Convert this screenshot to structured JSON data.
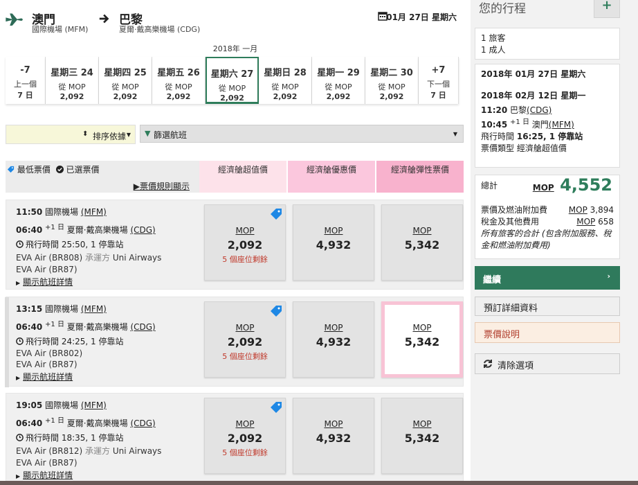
{
  "header": {
    "origin_city": "澳門",
    "origin_airport": "國際機場 (MFM)",
    "dest_city": "巴黎",
    "dest_airport": "夏爾·戴高樂機場 (CDG)",
    "date": "01月 27日 星期六"
  },
  "month_label": "2018年 一月",
  "dates": [
    {
      "name": "-7",
      "from": "上一個",
      "price": "7 日"
    },
    {
      "name": "星期三 24",
      "from": "從 MOP",
      "price": "2,092"
    },
    {
      "name": "星期四 25",
      "from": "從 MOP",
      "price": "2,092"
    },
    {
      "name": "星期五 26",
      "from": "從 MOP",
      "price": "2,092"
    },
    {
      "name": "星期六 27",
      "from": "從 MOP",
      "price": "2,092"
    },
    {
      "name": "星期日 28",
      "from": "從 MOP",
      "price": "2,092"
    },
    {
      "name": "星期一 29",
      "from": "從 MOP",
      "price": "2,092"
    },
    {
      "name": "星期二 30",
      "from": "從 MOP",
      "price": "2,092"
    },
    {
      "name": "+7",
      "from": "下一個",
      "price": "7 日"
    }
  ],
  "controls": {
    "sort_label": "排序依據",
    "filter_label": "篩選航班"
  },
  "legend": {
    "lowest": "最低票價",
    "selected": "已選票價",
    "rules": "票價規則顯示"
  },
  "fare_headers": [
    "經濟艙超值價",
    "經濟艙優惠價",
    "經濟艙彈性票價"
  ],
  "flights": [
    {
      "dep_time": "11:50",
      "dep_airport": "國際機場",
      "dep_code": "(MFM)",
      "arr_time": "06:40",
      "plus_day": "+1 日",
      "arr_airport": "夏爾·戴高樂機場",
      "arr_code": "(CDG)",
      "duration": "飛行時間 25:50, 1 停靠站",
      "seg1": "EVA Air (BR808)",
      "operated": "承運方",
      "operator": "Uni Airways",
      "seg2": "EVA Air (BR87)",
      "details": "顯示航班詳情",
      "fares": [
        {
          "cur": "MOP",
          "amt": "2,092",
          "seats": "5 個座位剩餘"
        },
        {
          "cur": "MOP",
          "amt": "4,932",
          "seats": ""
        },
        {
          "cur": "MOP",
          "amt": "5,342",
          "seats": ""
        }
      ]
    },
    {
      "dep_time": "13:15",
      "dep_airport": "國際機場",
      "dep_code": "(MFM)",
      "arr_time": "06:40",
      "plus_day": "+1 日",
      "arr_airport": "夏爾·戴高樂機場",
      "arr_code": "(CDG)",
      "duration": "飛行時間 24:25, 1 停靠站",
      "seg1": "EVA Air (BR802)",
      "operated": "",
      "operator": "",
      "seg2": "EVA Air (BR87)",
      "details": "顯示航班詳情",
      "fares": [
        {
          "cur": "MOP",
          "amt": "2,092",
          "seats": "5 個座位剩餘"
        },
        {
          "cur": "MOP",
          "amt": "4,932",
          "seats": ""
        },
        {
          "cur": "MOP",
          "amt": "5,342",
          "seats": ""
        }
      ]
    },
    {
      "dep_time": "19:05",
      "dep_airport": "國際機場",
      "dep_code": "(MFM)",
      "arr_time": "06:40",
      "plus_day": "+1 日",
      "arr_airport": "夏爾·戴高樂機場",
      "arr_code": "(CDG)",
      "duration": "飛行時間 18:35, 1 停靠站",
      "seg1": "EVA Air (BR812)",
      "operated": "承運方",
      "operator": "Uni Airways",
      "seg2": "EVA Air (BR87)",
      "details": "顯示航班詳情",
      "fares": [
        {
          "cur": "MOP",
          "amt": "2,092",
          "seats": "5 個座位剩餘"
        },
        {
          "cur": "MOP",
          "amt": "4,932",
          "seats": ""
        },
        {
          "cur": "MOP",
          "amt": "5,342",
          "seats": ""
        }
      ]
    }
  ],
  "itinerary": {
    "title": "您的行程",
    "plus": "+",
    "pax_count": "1 旅客",
    "pax_type": "1 成人",
    "outbound_date": "2018年 01月 27日 星期六",
    "return_date": "2018年 02月 12日 星期一",
    "ret_dep_time": "11:20",
    "ret_dep_city": "巴黎",
    "ret_dep_code": "(CDG)",
    "ret_arr_time": "10:45",
    "ret_plus": "+1 日",
    "ret_arr_city": "澳門",
    "ret_arr_code": "(MFM)",
    "ret_duration_label": "飛行時間",
    "ret_duration": "16:25, 1 停靠站",
    "fare_type": "票價類型 經濟艙超值價",
    "total_label": "總計",
    "total_cur": "MOP",
    "total_amt": "4,552",
    "fuel_label": "票價及燃油附加費",
    "fuel_cur": "MOP",
    "fuel_amt": "3,894",
    "tax_label": "稅金及其他費用",
    "tax_cur": "MOP",
    "tax_amt": "658",
    "note": "所有旅客的合計 (包含附加服務、稅金和燃油附加費用)",
    "continue": "繼續",
    "continue_chev": "›",
    "booking_details": "預訂詳細資料",
    "fare_info": "票價說明",
    "clear": "清除選項"
  },
  "colors": {
    "brand_green": "#2f7a5c",
    "seat_red": "#c0392b",
    "tag_blue": "#1e88e5"
  }
}
